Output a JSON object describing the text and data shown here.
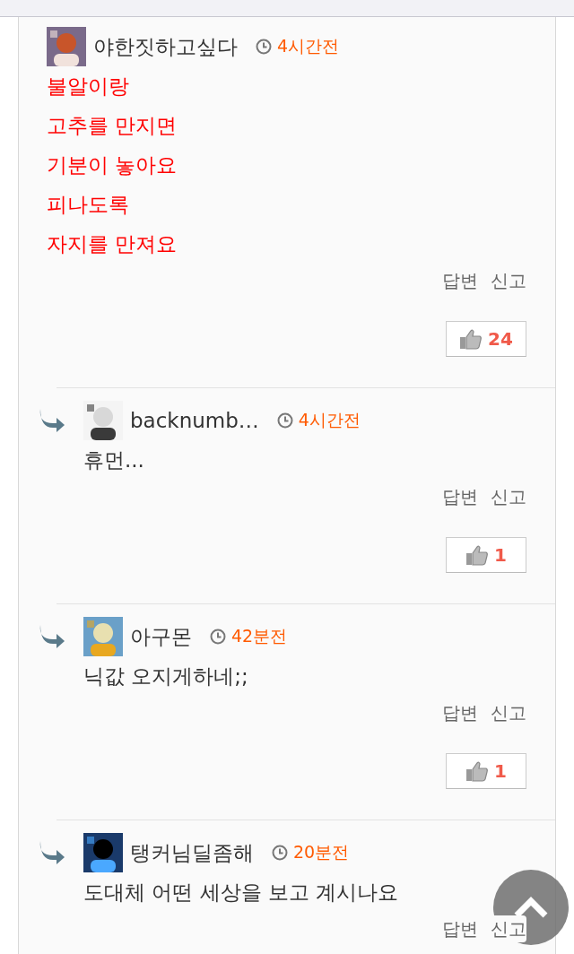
{
  "comments": [
    {
      "author": "야한짓하고싶다",
      "time": "4시간전",
      "reply": false,
      "highlighted": true,
      "body": [
        "불알이랑",
        "고추를 만지면",
        "기분이 놓아요",
        "피나도록",
        "자지를 만져요"
      ],
      "actions": [
        "답변",
        "신고"
      ],
      "likes": "24"
    },
    {
      "author": "backnumb…",
      "time": "4시간전",
      "reply": true,
      "highlighted": false,
      "body": [
        "휴먼..."
      ],
      "actions": [
        "답변",
        "신고"
      ],
      "likes": "1"
    },
    {
      "author": "아구몬",
      "time": "42분전",
      "reply": true,
      "highlighted": false,
      "body": [
        "닉값 오지게하네;;"
      ],
      "actions": [
        "답변",
        "신고"
      ],
      "likes": "1"
    },
    {
      "author": "탱커님딜좀해",
      "time": "20분전",
      "reply": true,
      "highlighted": false,
      "body": [
        "도대체 어떤 세상을 보고 계시나요"
      ],
      "actions": [
        "답변",
        "신고"
      ]
    }
  ]
}
